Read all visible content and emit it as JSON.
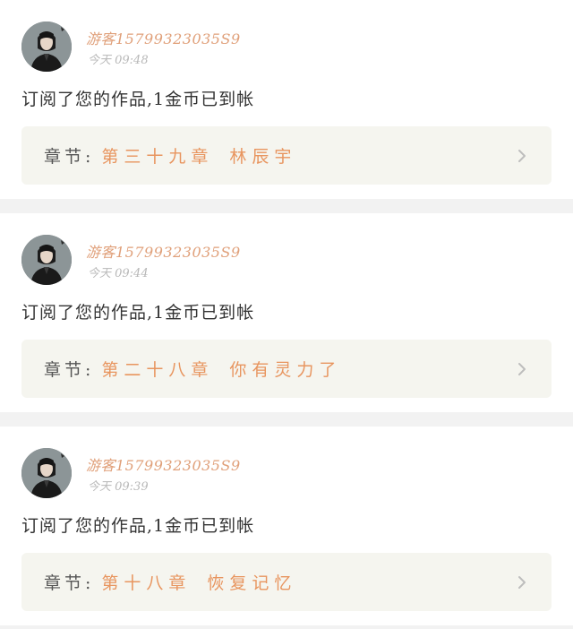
{
  "feed": {
    "items": [
      {
        "username": "游客15799323035S9",
        "time": "今天 09:48",
        "message": "订阅了您的作品,1金币已到帐",
        "chapter_prefix": "章节:",
        "chapter_number": "第三十九章",
        "chapter_title": "林辰宇"
      },
      {
        "username": "游客15799323035S9",
        "time": "今天 09:44",
        "message": "订阅了您的作品,1金币已到帐",
        "chapter_prefix": "章节:",
        "chapter_number": "第二十八章",
        "chapter_title": "你有灵力了"
      },
      {
        "username": "游客15799323035S9",
        "time": "今天 09:39",
        "message": "订阅了您的作品,1金币已到帐",
        "chapter_prefix": "章节:",
        "chapter_number": "第十八章",
        "chapter_title": "恢复记忆"
      }
    ]
  },
  "icons": {
    "avatar": "user-avatar-portrait",
    "chevron": "chevron-right-icon"
  },
  "colors": {
    "username": "#e0a07a",
    "timestamp": "#b8b8b8",
    "accent": "#e8955f",
    "chapter_box_bg": "#f5f5ef",
    "separator": "#f2f2f2",
    "chevron": "#bdbdbd"
  }
}
